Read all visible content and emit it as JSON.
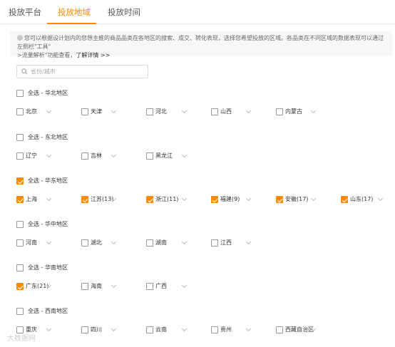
{
  "tabs": [
    {
      "label": "投放平台",
      "active": false
    },
    {
      "label": "投放地域",
      "active": true
    },
    {
      "label": "投放时间",
      "active": false
    }
  ],
  "notice": {
    "text": "您可以根据设计划内的您想主推的商品品类在各地区的搜索、成交、转化表现，选择您希望投放的区域。各品类在不同区域的数据表现可以通过左侧栏\"工具\"",
    "text2": ">流量解析\"功能查看，",
    "more": "了解详情 >>"
  },
  "search": {
    "placeholder": "省份/城市",
    "value": ""
  },
  "regions": [
    {
      "name": "全选 - 华北地区",
      "checked": false,
      "provinces": [
        {
          "label": "北京",
          "checked": false
        },
        {
          "label": "天津",
          "checked": false
        },
        {
          "label": "河北",
          "checked": false
        },
        {
          "label": "山西",
          "checked": false
        },
        {
          "label": "内蒙古",
          "checked": false
        }
      ]
    },
    {
      "name": "全选 - 东北地区",
      "checked": false,
      "provinces": [
        {
          "label": "辽宁",
          "checked": false
        },
        {
          "label": "吉林",
          "checked": false
        },
        {
          "label": "黑龙江",
          "checked": false
        }
      ]
    },
    {
      "name": "全选 - 华东地区",
      "checked": true,
      "provinces": [
        {
          "label": "上海",
          "checked": true
        },
        {
          "label": "江苏(13)",
          "checked": true
        },
        {
          "label": "浙江(11)",
          "checked": true
        },
        {
          "label": "福建(9)",
          "checked": true
        },
        {
          "label": "安徽(17)",
          "checked": true
        },
        {
          "label": "山东(17)",
          "checked": true
        }
      ]
    },
    {
      "name": "全选 - 华中地区",
      "checked": false,
      "provinces": [
        {
          "label": "河南",
          "checked": false
        },
        {
          "label": "湖北",
          "checked": false
        },
        {
          "label": "湖南",
          "checked": false
        },
        {
          "label": "江西",
          "checked": false
        }
      ]
    },
    {
      "name": "全选 - 华南地区",
      "checked": false,
      "provinces": [
        {
          "label": "广东(21)",
          "checked": true
        },
        {
          "label": "海南",
          "checked": false
        },
        {
          "label": "广西",
          "checked": false
        }
      ]
    },
    {
      "name": "全选 - 西南地区",
      "checked": false,
      "provinces": [
        {
          "label": "重庆",
          "checked": false
        },
        {
          "label": "四川",
          "checked": false
        },
        {
          "label": "云南",
          "checked": false
        },
        {
          "label": "贵州",
          "checked": false
        },
        {
          "label": "西藏自治区",
          "checked": false
        }
      ]
    }
  ],
  "colors": {
    "accent": "#ff8a00"
  },
  "watermark": "大数据网"
}
